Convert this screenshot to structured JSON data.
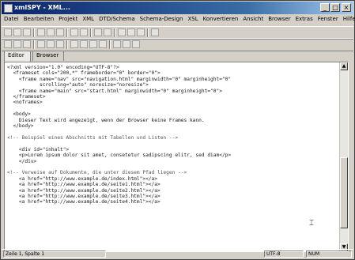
{
  "window": {
    "title": "xmlSPY - XML...",
    "minimize": "_",
    "maximize": "□",
    "close": "×"
  },
  "menu": [
    "Datei",
    "Bearbeiten",
    "Projekt",
    "XML",
    "DTD/Schema",
    "Schema-Design",
    "XSL",
    "Konvertieren",
    "Ansicht",
    "Browser",
    "Extras",
    "Fenster",
    "Hilfe"
  ],
  "tabs": [
    "Editor",
    "Browser"
  ],
  "editor": {
    "lines": [
      "<?xml version=\"1.0\" encoding=\"UTF-8\"?>",
      "  <frameset cols=\"200,*\" frameborder=\"0\" border=\"0\">",
      "    <frame name=\"nav\" src=\"navigation.html\" marginwidth=\"0\" marginheight=\"0\"",
      "           scrolling=\"auto\" noresize=\"noresize\">",
      "    <frame name=\"main\" src=\"start.html\" marginwidth=\"0\" marginheight=\"0\">",
      "  </frameset>",
      "  <noframes>",
      "",
      "  <body>",
      "    Dieser Text wird angezeigt, wenn der Browser keine Frames kann.",
      "  </body>",
      "",
      "<!-- Beispiel eines Abschnitts mit Tabellen und Listen -->",
      "",
      "    <div id=\"inhalt\">",
      "    <p>Lorem ipsum dolor sit amet, consetetur sadipscing elitr, sed diam</p>",
      "    </div>",
      "",
      "<!-- Verweise auf Dokumente, die unter diesem Pfad liegen -->",
      "    <a href=\"http://www.example.de/index.html\"></a>",
      "    <a href=\"http://www.example.de/seite1.html\"></a>",
      "    <a href=\"http://www.example.de/seite2.html\"></a>",
      "    <a href=\"http://www.example.de/seite3.html\"></a>",
      "    <a href=\"http://www.example.de/seite4.html\"></a>"
    ]
  },
  "status": {
    "left": "Zeile 1, Spalte 1",
    "mid": "UTF-8",
    "right": "NUM"
  },
  "scroll": {
    "up": "▲",
    "down": "▼"
  },
  "cursor_glyph": "⌶"
}
